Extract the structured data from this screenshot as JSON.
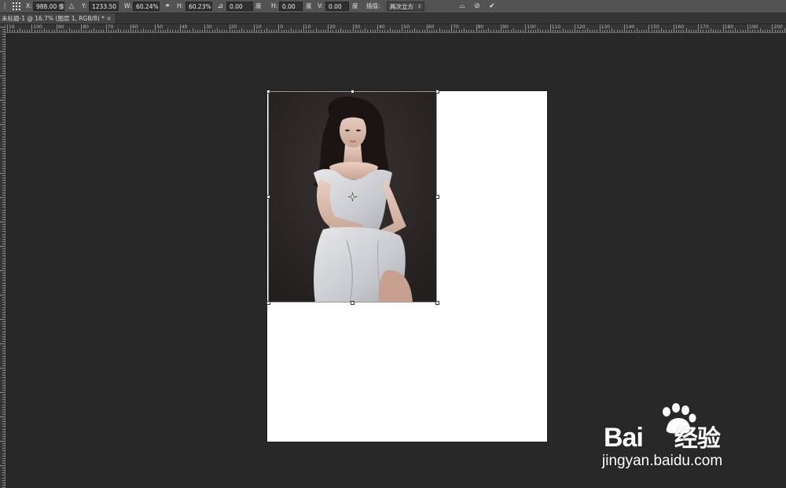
{
  "options_bar": {
    "x_label": "X:",
    "x_value": "988.00 像素",
    "delta_icon": "delta-icon",
    "y_label": "Y:",
    "y_value": "1233.50 像",
    "w_label": "W:",
    "w_value": "60.24%",
    "link_icon": "link-icon",
    "h_label": "H:",
    "h_value": "60.23%",
    "angle_icon": "angle-icon",
    "angle_value": "0.00",
    "angle_unit": "度",
    "hskew_label": "H:",
    "hskew_value": "0.00",
    "hskew_unit": "度",
    "vskew_label": "V:",
    "vskew_value": "0.00",
    "vskew_unit": "度",
    "interp_label": "插值:",
    "interp_value": "两次立方",
    "warp_icon": "warp-icon",
    "cancel_icon": "cancel-icon",
    "commit_icon": "commit-icon"
  },
  "tab": {
    "title": "未标题-1 @ 16.7% (图层 1, RGB/8) *",
    "close": "×"
  },
  "ruler": {
    "labels": [
      "10",
      "100",
      "90",
      "80",
      "70",
      "60",
      "50",
      "40",
      "30",
      "20",
      "10",
      "0",
      "10",
      "20",
      "30",
      "40",
      "50",
      "60",
      "70",
      "80",
      "90",
      "100",
      "110",
      "120",
      "130",
      "140",
      "150",
      "160",
      "170",
      "180",
      "190",
      "200",
      "21"
    ]
  },
  "watermark": {
    "brand": "Bai",
    "brand_suffix": "经验",
    "url": "jingyan.baidu.com"
  },
  "colors": {
    "workspace": "#282828",
    "options_bar": "#535353",
    "canvas": "#ffffff"
  }
}
